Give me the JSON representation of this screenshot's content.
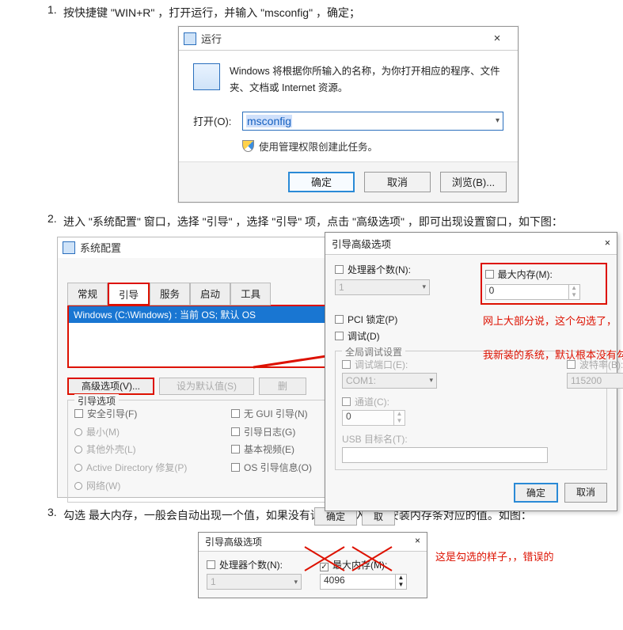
{
  "step1": {
    "num": "1.",
    "text": "按快捷键 \"WIN+R\" ，打开运行，并输入 \"msconfig\" ，确定；"
  },
  "run_dialog": {
    "title": "运行",
    "close": "×",
    "description": "Windows 将根据你所输入的名称，为你打开相应的程序、文件夹、文档或 Internet 资源。",
    "open_label": "打开(O):",
    "open_value": "msconfig",
    "admin_note": "使用管理权限创建此任务。",
    "btn_ok": "确定",
    "btn_cancel": "取消",
    "btn_browse": "浏览(B)..."
  },
  "step2": {
    "num": "2.",
    "text": "进入 \"系统配置\" 窗口，选择 \"引导\" ，选择 \"引导\" 项，点击 \"高级选项\" ，即可出现设置窗口，如下图："
  },
  "sysconf": {
    "title": "系统配置",
    "tabs": {
      "t1": "常规",
      "t2": "引导",
      "t3": "服务",
      "t4": "启动",
      "t5": "工具"
    },
    "boot_entry": "Windows (C:\\Windows) : 当前 OS; 默认 OS",
    "btn_adv": "高级选项(V)...",
    "btn_default": "设为默认值(S)",
    "btn_delete": "删",
    "group_title": "引导选项",
    "opt_safe": "安全引导(F)",
    "opt_min": "最小(M)",
    "opt_shell": "其他外壳(L)",
    "opt_ad": "Active Directory 修复(P)",
    "opt_net": "网络(W)",
    "opt_nogui": "无 GUI 引导(N)",
    "opt_log": "引导日志(G)",
    "opt_basevideo": "基本视频(E)",
    "opt_osinfo": "OS 引导信息(O)",
    "btn_ok": "确定",
    "btn_cancel": "取"
  },
  "adv": {
    "title": "引导高级选项",
    "close": "×",
    "cpu_label": "处理器个数(N):",
    "cpu_value": "1",
    "mem_label": "最大内存(M):",
    "mem_value": "0",
    "pci": "PCI 锁定(P)",
    "debug": "调试(D)",
    "group_title": "全局调试设置",
    "debug_port": "调试端口(E):",
    "debug_port_val": "COM1:",
    "baud": "波特率(B):",
    "baud_val": "115200",
    "channel": "通道(C):",
    "channel_val": "0",
    "usb": "USB 目标名(T):",
    "btn_ok": "确定",
    "btn_cancel": "取消"
  },
  "annot": {
    "a1": "网上大部分说，这个勾选了，",
    "a2": "我新装的系统，默认根本没有勾选"
  },
  "step3": {
    "num": "3.",
    "text": "勾选 最大内存，一般会自动出现一个值，如果没有请自行输入与所安装内存条对应的值。如图："
  },
  "adv2": {
    "title": "引导高级选项",
    "close": "×",
    "cpu_label": "处理器个数(N):",
    "cpu_value": "1",
    "mem_label": "最大内存(M):",
    "mem_value": "4096"
  },
  "annot3": "这是勾选的样子，，错误的"
}
